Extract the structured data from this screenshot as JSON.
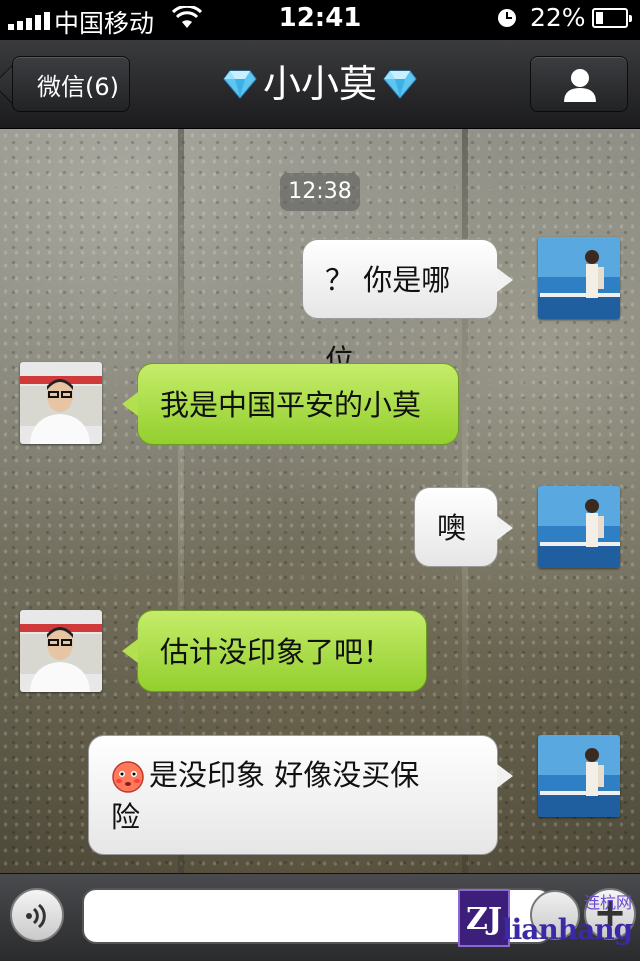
{
  "status_bar": {
    "carrier": "中国移动",
    "time": "12:41",
    "battery_percent": "22%"
  },
  "nav": {
    "back_label": "微信(6)",
    "title": "小小莫"
  },
  "chat": {
    "timestamp": "12:38",
    "messages": [
      {
        "side": "right",
        "color": "white",
        "text": "？ 你是哪位"
      },
      {
        "side": "left",
        "color": "green",
        "text": "我是中国平安的小莫"
      },
      {
        "side": "right",
        "color": "white",
        "text": "噢"
      },
      {
        "side": "left",
        "color": "green",
        "text": "估计没印象了吧！"
      },
      {
        "side": "right",
        "color": "white",
        "emoji": "blush-face-emoji",
        "text_line1": "是没印象 好像没买保",
        "text_line2": "险"
      }
    ]
  },
  "input_bar": {
    "placeholder": ""
  },
  "watermark": {
    "logo": "ZJ",
    "text": "lianhang",
    "site": "连杭网"
  },
  "colors": {
    "green_bubble": "#a6dc42",
    "white_bubble": "#f2f2f2",
    "nav_bg": "#2b2c2e"
  }
}
